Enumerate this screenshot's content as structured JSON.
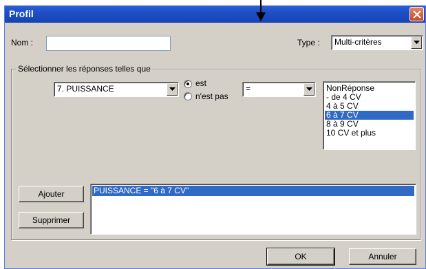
{
  "window": {
    "title": "Profil"
  },
  "form": {
    "name_label": "Nom :",
    "name_value": "",
    "type_label": "Type :",
    "type_value": "Multi-critères"
  },
  "criteria": {
    "group_label": "Sélectionner les réponses telles que",
    "variable_value": "7. PUISSANCE",
    "radio_options": [
      "est",
      "n'est pas"
    ],
    "selected_radio": "est",
    "operator_value": "=",
    "responses": [
      "NonRéponse",
      "- de 4 CV",
      "4 à 5 CV",
      "6 à 7 CV",
      "8 à 9 CV",
      "10 CV et plus"
    ],
    "selected_response": "6 à 7 CV",
    "add_label": "Ajouter",
    "remove_label": "Supprimer",
    "conditions": [
      "PUISSANCE = \"6 à 7 CV\""
    ]
  },
  "buttons": {
    "ok_label": "OK",
    "cancel_label": "Annuler"
  },
  "colors": {
    "titlebar": "#1e4fc4",
    "selection": "#316ac5",
    "dialog": "#d4d0c8",
    "close": "#d5562e"
  },
  "icons": {
    "close": "close-icon",
    "dropdown": "chevron-down-icon",
    "pointer": "down-arrow-icon"
  }
}
